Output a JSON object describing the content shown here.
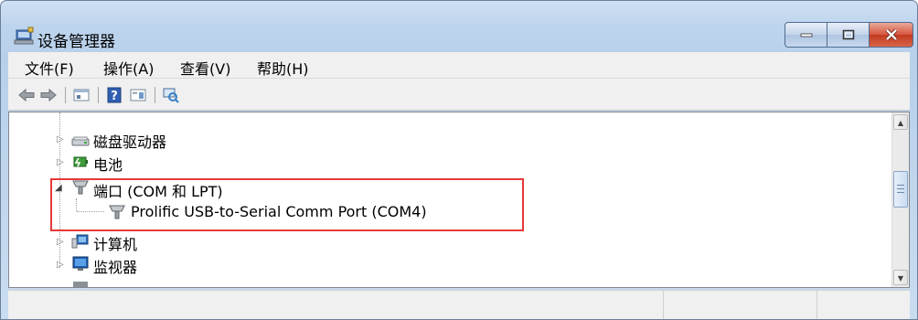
{
  "window": {
    "title": "设备管理器"
  },
  "menu": {
    "items": [
      {
        "label": "文件(F)"
      },
      {
        "label": "操作(A)"
      },
      {
        "label": "查看(V)"
      },
      {
        "label": "帮助(H)"
      }
    ]
  },
  "toolbar": {
    "icons": [
      "back-arrow-icon",
      "forward-arrow-icon",
      "properties-icon",
      "help-icon",
      "action-pane-icon",
      "scan-hardware-icon"
    ]
  },
  "tree": {
    "items": [
      {
        "label": "磁盘驱动器",
        "icon": "disk-drive-icon",
        "expanded": false
      },
      {
        "label": "电池",
        "icon": "battery-icon",
        "expanded": false
      },
      {
        "label": "端口 (COM 和 LPT)",
        "icon": "port-icon",
        "expanded": true
      },
      {
        "label": "Prolific USB-to-Serial Comm Port (COM4)",
        "icon": "port-icon",
        "child": true
      },
      {
        "label": "计算机",
        "icon": "computer-icon",
        "expanded": false
      },
      {
        "label": "监视器",
        "icon": "monitor-icon",
        "expanded": false
      }
    ]
  },
  "colors": {
    "highlight_border": "#e5393a",
    "close_button": "#c23a1f"
  }
}
